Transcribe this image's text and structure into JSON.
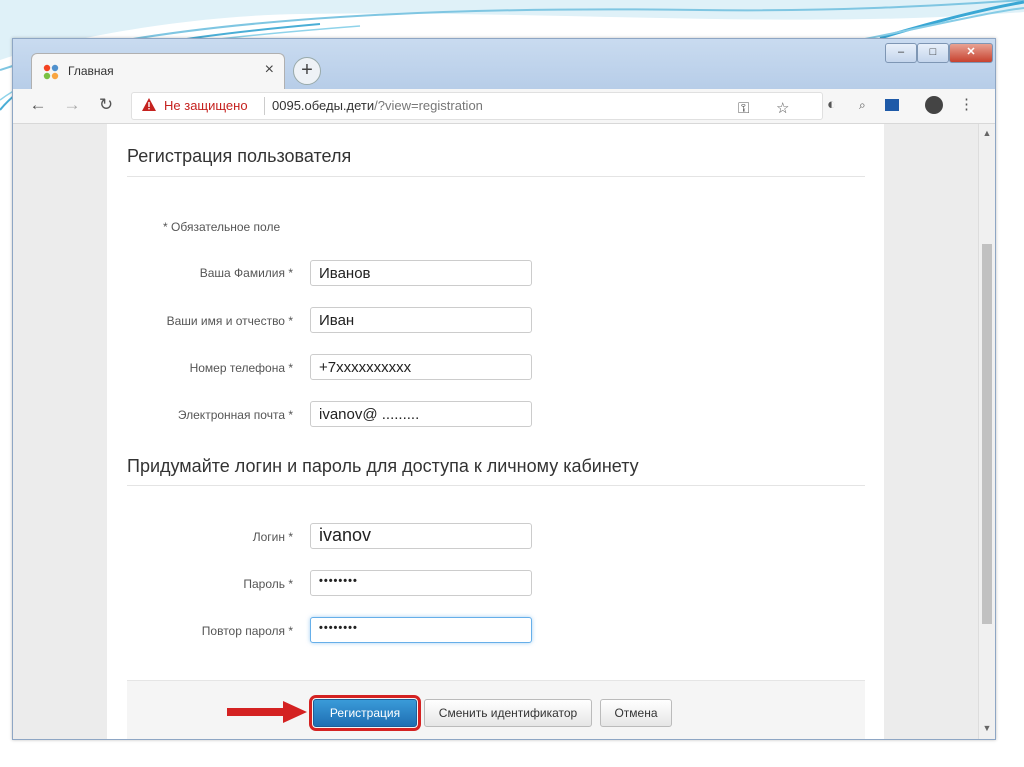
{
  "browser": {
    "tab_title": "Главная",
    "tab_close": "×",
    "new_tab": "+",
    "window_controls": {
      "minimize": "–",
      "maximize": "□",
      "close": "✕"
    },
    "security_label": "Не защищено",
    "url_host": "0095.обеды.дети",
    "url_path": "/?view=registration"
  },
  "form": {
    "title": "Регистрация пользователя",
    "required_note": "* Обязательное поле",
    "fields": [
      {
        "label": "Ваша Фамилия *",
        "value": "Иванов"
      },
      {
        "label": "Ваши имя и отчество *",
        "value": "Иван"
      },
      {
        "label": "Номер телефона *",
        "value": "+7xxxxxxxxxx"
      },
      {
        "label": "Электронная почта *",
        "value": "ivanov@ ........."
      }
    ],
    "login_section_title": "Придумайте логин и пароль для доступа к личному кабинету",
    "login_fields": [
      {
        "label": "Логин *",
        "value": "ivanov"
      },
      {
        "label": "Пароль *",
        "value": "••••••••"
      },
      {
        "label": "Повтор пароля *",
        "value": "••••••••"
      }
    ],
    "buttons": {
      "register": "Регистрация",
      "change_id": "Сменить идентификатор",
      "cancel": "Отмена"
    }
  },
  "colors": {
    "primary_button": "#2a86c8",
    "highlight_box": "#d42222",
    "insecure_text": "#c5221f"
  },
  "icons": [
    "joomla-favicon",
    "back-icon",
    "forward-icon",
    "reload-icon",
    "warning-icon",
    "key-icon",
    "star-icon",
    "extension-icon",
    "search-extension-icon",
    "flag-extension-icon",
    "avatar-icon",
    "menu-icon",
    "red-arrow-icon"
  ]
}
